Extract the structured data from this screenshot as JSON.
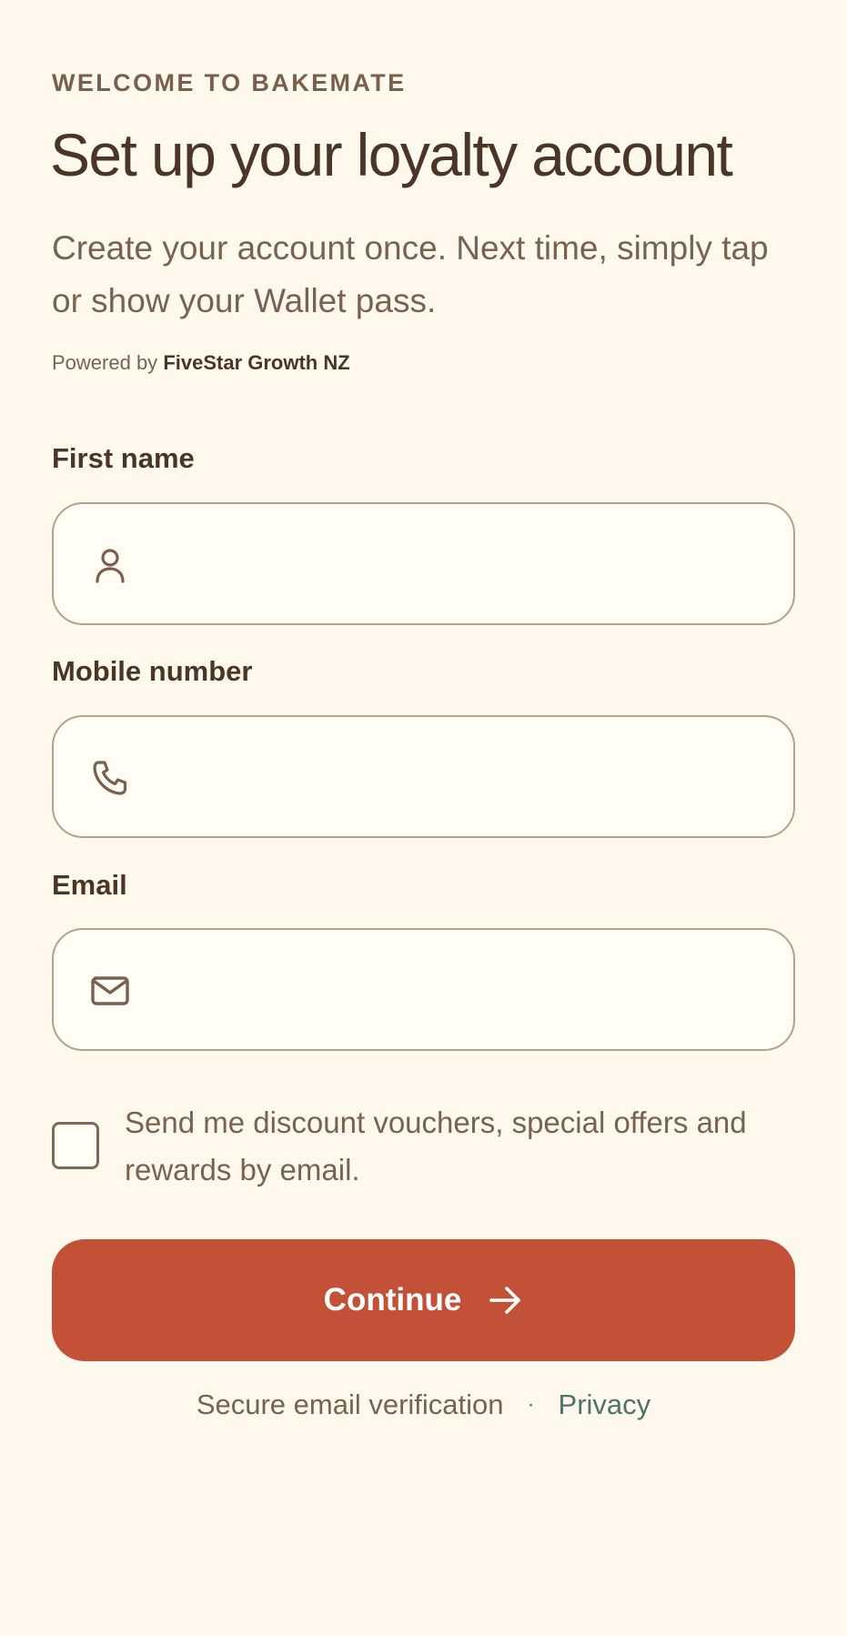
{
  "header": {
    "eyebrow": "WELCOME TO BAKEMATE",
    "title": "Set up your loyalty account",
    "subtitle": "Create your account once. Next time, simply tap or show your Wallet pass.",
    "powered_prefix": "Powered by",
    "powered_brand": "FiveStar Growth NZ"
  },
  "form": {
    "first_name": {
      "label": "First name",
      "icon": "user-icon",
      "value": "",
      "placeholder": ""
    },
    "mobile": {
      "label": "Mobile number",
      "icon": "phone-icon",
      "value": "",
      "placeholder": ""
    },
    "email": {
      "label": "Email",
      "icon": "mail-icon",
      "value": "",
      "placeholder": ""
    },
    "marketing_opt_in": {
      "label": "Send me discount vouchers, special offers and rewards by email.",
      "checked": false
    },
    "submit_label": "Continue",
    "submit_icon": "arrow-right-icon"
  },
  "footer": {
    "secure_text": "Secure email verification",
    "separator": "·",
    "privacy_label": "Privacy"
  },
  "colors": {
    "background": "#fff9ed",
    "primary": "#c35138",
    "text_dark": "#4a3526",
    "text_muted": "#7a6250",
    "link": "#4f7366",
    "field_border": "#b5a08b"
  }
}
